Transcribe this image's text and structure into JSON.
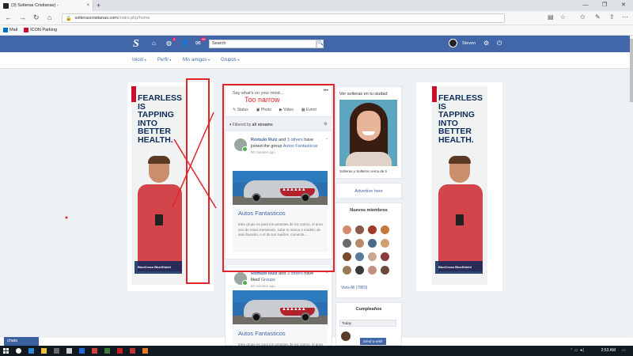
{
  "browser": {
    "tab_title": "(3) Solteras Cristianas) -",
    "tab_close": "×",
    "new_tab": "+",
    "window_controls": [
      "—",
      "❐",
      "✕"
    ],
    "url_host": "solterascristianas.com",
    "url_path": "/index.php/home",
    "bookmarks": [
      {
        "label": "Mail",
        "icon": "outlook-icon",
        "color": "#0072c6"
      },
      {
        "label": "ICON Parking",
        "icon": "parking-icon",
        "color": "#c8102e"
      }
    ]
  },
  "site": {
    "logo": "S",
    "accent": "#4267a8",
    "search_placeholder": "Search",
    "search_icon": "🔍",
    "globe_badge": "2",
    "mail_badge": "99",
    "username": "Steven",
    "subnav": [
      {
        "label": "Inicio",
        "active": true
      },
      {
        "label": "Perfil"
      },
      {
        "label": "Mis amigos"
      },
      {
        "label": "Grupos"
      }
    ]
  },
  "ad": {
    "headline": "FEARLESS\nIS\nTAPPING\nINTO\nBETTER\nHEALTH.",
    "brand": "BlueCross BlueShield"
  },
  "composer": {
    "prompt": "Say what's on your mind...",
    "menu": "•••",
    "tabs": [
      "Status",
      "Photo",
      "Video",
      "Event"
    ],
    "filter_prefix": "Filtered by",
    "filter_value": "all streams"
  },
  "posts": [
    {
      "author": "Romulo Ruiz",
      "mid": "and",
      "others": "3 others",
      "verb": "have joined the group",
      "group_link": "Autos Fantasticos",
      "time": "50 minutes ago",
      "group_title": "Autos Fantasticos",
      "group_desc": "Este grupo es para los amantes de los carros, el area uno de estos tremiendo, sube tu marca o modelo de auto favorito, o el de tus sueños, comenta..."
    },
    {
      "author": "Romulo Ruiz",
      "mid": "and",
      "others": "3 others",
      "verb": "have liked",
      "group_link": "Groups",
      "time": "50 minutes ago",
      "group_title": "Autos Fantasticos",
      "group_desc": "Este grupo es para los amantes de los carros, el area uno de estos tremiendo"
    }
  ],
  "sidebar": {
    "profile_title": "Ver solteras en tu ciudad",
    "profile_caption": "Solteras y Solteros cerca de ti",
    "advertise": "Advertise here",
    "members_title": "Nuevos miembros",
    "members_colors": [
      "#d58a6e",
      "#8a5a4a",
      "#a33a2a",
      "#c47a3a",
      "#6a6a6a",
      "#b88a6a",
      "#4a6a8a",
      "#d0a070",
      "#7a4a2a",
      "#5a7a9a",
      "#caa890",
      "#8a3a3a",
      "#9a7a5a",
      "#3a3a3a",
      "#c09080",
      "#6a4a3a"
    ],
    "view_all": "View All (7883)",
    "bday_title": "Cumpleaños",
    "bday_today": "Today",
    "bday_button": "Send a wish"
  },
  "chat_label": "chats",
  "clock": "2:53 AM",
  "annotation": {
    "text": "Too narrow",
    "color": "#e0242a"
  }
}
